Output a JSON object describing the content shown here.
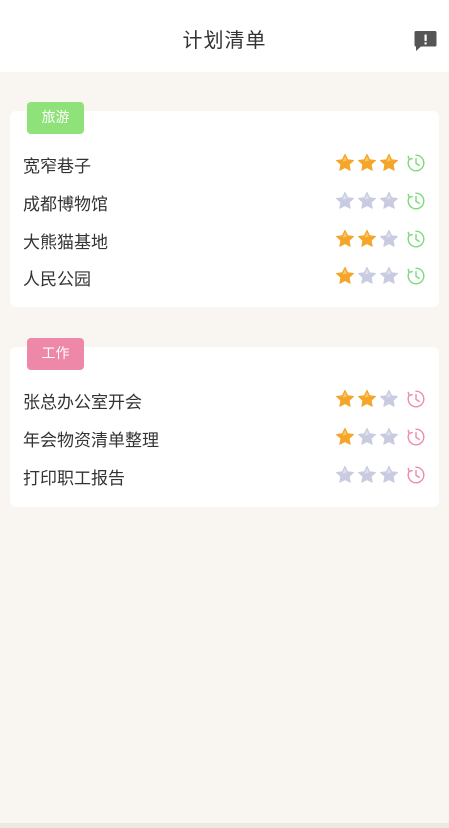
{
  "header": {
    "title": "计划清单",
    "feedback_icon": "feedback-icon"
  },
  "colors": {
    "travel_tag": "#8fe27a",
    "work_tag": "#ed88a8",
    "star_filled": "#f4a52a",
    "star_empty": "#c9cbe0",
    "clock_travel": "#7cd97a",
    "clock_work": "#f08aa6"
  },
  "groups": [
    {
      "tag": "旅游",
      "items": [
        {
          "label": "宽窄巷子",
          "stars": 3
        },
        {
          "label": "成都博物馆",
          "stars": 0
        },
        {
          "label": "大熊猫基地",
          "stars": 2
        },
        {
          "label": "人民公园",
          "stars": 1
        }
      ]
    },
    {
      "tag": "工作",
      "items": [
        {
          "label": "张总办公室开会",
          "stars": 2
        },
        {
          "label": "年会物资清单整理",
          "stars": 1
        },
        {
          "label": "打印职工报告",
          "stars": 0
        }
      ]
    }
  ]
}
